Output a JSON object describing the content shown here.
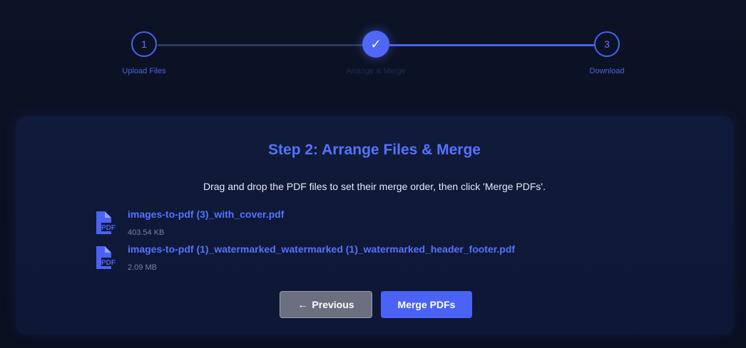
{
  "stepper": {
    "steps": [
      {
        "number": "1",
        "label": "Upload Files"
      },
      {
        "number": "✓",
        "label": "Arrange & Merge"
      },
      {
        "number": "3",
        "label": "Download"
      }
    ]
  },
  "card": {
    "title": "Step 2: Arrange Files & Merge",
    "description": "Drag and drop the PDF files to set their merge order, then click 'Merge PDFs'.",
    "files": [
      {
        "name": "images-to-pdf (3)_with_cover.pdf",
        "size": "403.54 KB",
        "icon": "pdf-file-icon"
      },
      {
        "name": "images-to-pdf (1)_watermarked_watermarked (1)_watermarked_header_footer.pdf",
        "size": "2.09 MB",
        "icon": "pdf-file-icon"
      }
    ],
    "buttons": {
      "previous_arrow": "←",
      "previous_label": "Previous",
      "merge_label": "Merge PDFs"
    }
  },
  "colors": {
    "accent": "#4a63f5",
    "title": "#5573ff",
    "background": "#0b1021"
  }
}
